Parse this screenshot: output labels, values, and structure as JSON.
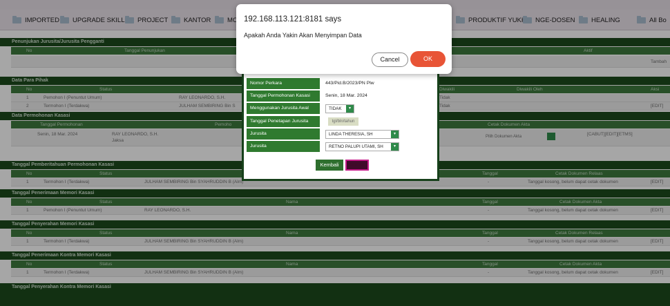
{
  "bookmarks": [
    "IMPORTED",
    "UPGRADE SKILL",
    "PROJECT",
    "KANTOR",
    "MO",
    "PRODUKTIF YUKK",
    "NGE-DOSEN",
    "HEALING",
    "All Bo"
  ],
  "sections": {
    "penunjukan": {
      "title": "Penunjukan Jurusita/Jurusita Pengganti",
      "h_no": "No",
      "h_tanggal": "Tanggal Penunjukan",
      "h_aktif": "Aktif",
      "tambah": "Tambah"
    },
    "para_pihak": {
      "title": "Data Para Pihak",
      "h_no": "No",
      "h_status": "Status",
      "h_diwakili": "Diwakili",
      "h_diwakili_oleh": "Diwakili Oleh",
      "h_aksi": "Aksi",
      "rows": [
        {
          "no": "1",
          "status": "Pemohon I (Penuntut Umum)",
          "nama": "RAY LEONARDO, S.H.",
          "diwakili": "Tidak"
        },
        {
          "no": "2",
          "status": "Termohon I (Terdakwa)",
          "nama": "JULHAM SEMBIRING Bin S",
          "diwakili": "Tidak",
          "aksi": "[EDIT]"
        }
      ]
    },
    "permohonan": {
      "title": "Data Permohonan Kasasi",
      "h_tanggal": "Tanggal Permohonan",
      "h_pemohon": "Pemoho",
      "h_cetak": "Cetak Dokumen Akta",
      "tanggal": "Senin, 18 Mar. 2024",
      "nama": "RAY LEONARDO, S.H.",
      "jabatan": "Jaksa",
      "pilih": "Pilih Dokumen Akta",
      "aksi": "[CABUT][EDIT][ETMS]"
    },
    "pemberitahuan": {
      "title": "Tanggal Pemberitahuan Permohonan Kasasi",
      "h_no": "No",
      "h_status": "Status",
      "h_tanggal": "Tanggal",
      "h_cetak": "Cetak Dokumen Relaas",
      "no": "1",
      "status": "Termohon I (Terdakwa)",
      "nama": "JULHAM SEMBIRING Bin SYAHRUDDIN B (Alm)",
      "tanggal": "-",
      "cetak": "Tanggal kosong, belum dapat cetak dokumen",
      "aksi": "[EDIT]"
    },
    "memori": {
      "title": "Tanggal Penerimaan Memori Kasasi",
      "h_no": "No",
      "h_status": "Status",
      "h_nama": "Nama",
      "h_tanggal": "Tanggal",
      "h_cetak": "Cetak Dokumen Akta",
      "no": "1",
      "status": "Pemohon I (Penuntut Umum)",
      "nama": "RAY LEONARDO, S.H.",
      "tanggal": "-",
      "cetak": "Tanggal kosong, belum dapat cetak dokumen",
      "aksi": "[EDIT]"
    },
    "penyerahan": {
      "title": "Tanggal Penyerahan Memori Kasasi",
      "h_no": "No",
      "h_status": "Status",
      "h_nama": "Nama",
      "h_tanggal": "Tanggal",
      "h_cetak": "Cetak Dokumen Relaas",
      "no": "1",
      "status": "Termohon I (Terdakwa)",
      "nama": "JULHAM SEMBIRING Bin SYAHRUDDIN B (Alm)",
      "tanggal": "-",
      "cetak": "Tanggal kosong, belum dapat cetak dokumen",
      "aksi": "[EDIT]"
    },
    "kontra": {
      "title": "Tanggal Penerimaan Kontra Memori Kasasi",
      "h_no": "No",
      "h_status": "Status",
      "h_nama": "Nama",
      "h_tanggal": "Tanggal",
      "h_cetak": "Cetak Dokumen Akta",
      "no": "1",
      "status": "Termohon I (Terdakwa)",
      "nama": "JULHAM SEMBIRING Bin SYAHRUDDIN B (Alm)",
      "tanggal": "-",
      "cetak": "Tanggal kosong, belum dapat cetak dokumen",
      "aksi": "[EDIT]"
    },
    "penyerahan_kontra": {
      "title": "Tanggal Penyerahan Kontra Memori Kasasi"
    }
  },
  "modal": {
    "nomor_label": "Nomor Perkara",
    "nomor_value": "443/Pid.B/2023/PN Plw",
    "tgl_label": "Tanggal Permohonan Kasasi",
    "tgl_value": "Senin, 18 Mar. 2024",
    "awal_label": "Menggunakan Jurusita Awal",
    "awal_value": "TIDAK",
    "penetapan_label": "Tanggal Penetapan Jurusita",
    "penetapan_placeholder": "tgl/bln/tahun",
    "js1_label": "Jurusita",
    "js1_value": "LINDA THERESIA, SH",
    "js2_label": "Jurusita",
    "js2_value": "RETNO PALUPI UTAMI, SH",
    "kembali": "Kembali",
    "simpan": "Simpan"
  },
  "dialog": {
    "title": "192.168.113.121:8181 says",
    "message": "Apakah Anda Yakin Akan Menyimpan Data",
    "cancel": "Cancel",
    "ok": "OK"
  },
  "colors": {
    "section_bg": "#1c4a1c",
    "header_bg": "#3e7a3e",
    "ok_button": "#e85436"
  }
}
